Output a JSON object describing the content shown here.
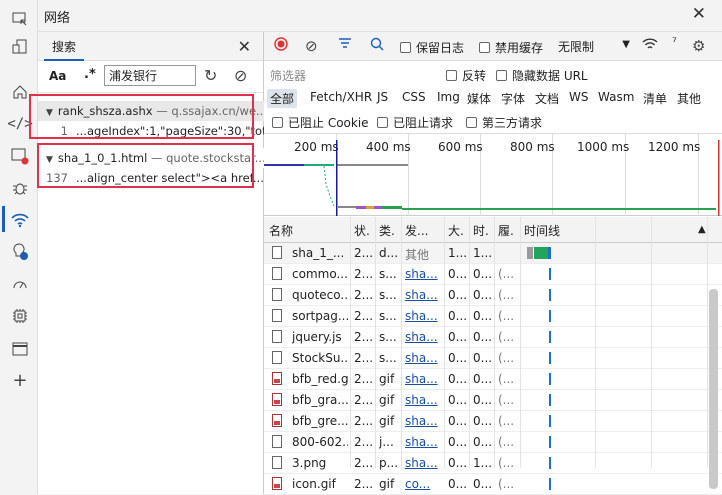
{
  "title": "网络",
  "search": {
    "tab_label": "搜索",
    "match_case": "Aa",
    "regex": ".*",
    "query": "浦发银行",
    "results": [
      {
        "file": "rank_shsza.ashx",
        "sep": " — ",
        "url": "q.ssajax.cn/we...",
        "line": "1",
        "snippet": "...ageIndex\":1,\"pageSize\":30,\"tot..."
      },
      {
        "file": "sha_1_0_1.html",
        "sep": " — ",
        "url": "quote.stockstar...",
        "line": "137",
        "snippet": "...align_center select\"><a href..."
      }
    ]
  },
  "toolbar": {
    "preserve_log": "保留日志",
    "disable_cache": "禁用缓存",
    "throttling": "无限制"
  },
  "filter": {
    "placeholder": "筛选器",
    "invert": "反转",
    "hide_data_urls": "隐藏数据 URL"
  },
  "types": [
    "全部",
    "Fetch/XHR",
    "JS",
    "CSS",
    "Img",
    "媒体",
    "字体",
    "文档",
    "WS",
    "Wasm",
    "清单",
    "其他"
  ],
  "blocked": {
    "blocked_cookies": "已阻止 Cookie",
    "blocked_requests": "已阻止请求",
    "third_party": "第三方请求"
  },
  "overview_ticks": [
    "200 ms",
    "400 ms",
    "600 ms",
    "800 ms",
    "1000 ms",
    "1200 ms"
  ],
  "columns": [
    "名称",
    "状.",
    "类.",
    "发...",
    "大.",
    "时.",
    "履.",
    "时间线"
  ],
  "rows": [
    {
      "name": "sha_1_...",
      "status": "2...",
      "type": "d...",
      "initiator": "其他",
      "size": "1...",
      "time": "1...",
      "hist": ""
    },
    {
      "name": "commo...",
      "status": "2...",
      "type": "s...",
      "initiator": "sha...",
      "size": "0...",
      "time": "0...",
      "hist": "(..."
    },
    {
      "name": "quoteco...",
      "status": "2...",
      "type": "s...",
      "initiator": "sha...",
      "size": "0...",
      "time": "0...",
      "hist": "(..."
    },
    {
      "name": "sortpag...",
      "status": "2...",
      "type": "s...",
      "initiator": "sha...",
      "size": "0...",
      "time": "0...",
      "hist": "(..."
    },
    {
      "name": "jquery.js",
      "status": "2...",
      "type": "s...",
      "initiator": "sha...",
      "size": "0...",
      "time": "0...",
      "hist": "(..."
    },
    {
      "name": "StockSu...",
      "status": "2...",
      "type": "s...",
      "initiator": "sha...",
      "size": "0...",
      "time": "0...",
      "hist": "(..."
    },
    {
      "name": "bfb_red.gif",
      "status": "2...",
      "type": "gif",
      "initiator": "sha...",
      "size": "0...",
      "time": "0...",
      "hist": "(..."
    },
    {
      "name": "bfb_gra...",
      "status": "2...",
      "type": "gif",
      "initiator": "sha...",
      "size": "0...",
      "time": "0...",
      "hist": "(..."
    },
    {
      "name": "bfb_gre...",
      "status": "2...",
      "type": "gif",
      "initiator": "sha...",
      "size": "0...",
      "time": "0...",
      "hist": "(..."
    },
    {
      "name": "800-602...",
      "status": "2...",
      "type": "j...",
      "initiator": "sha...",
      "size": "0...",
      "time": "0...",
      "hist": "(..."
    },
    {
      "name": "3.png",
      "status": "2...",
      "type": "p...",
      "initiator": "sha...",
      "size": "0...",
      "time": "1...",
      "hist": "(..."
    },
    {
      "name": "icon.gif",
      "status": "2...",
      "type": "gif",
      "initiator": "co...",
      "size": "0...",
      "time": "0...",
      "hist": "(..."
    }
  ]
}
